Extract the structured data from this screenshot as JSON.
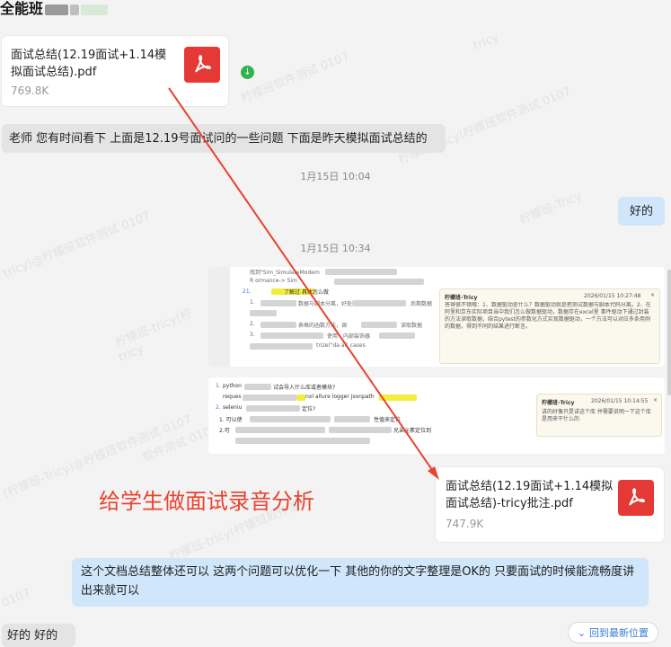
{
  "header": {
    "title": "全能班"
  },
  "messages": {
    "file1": {
      "name": "面试总结(12.19面试+1.14模拟面试总结).pdf",
      "size": "769.8K"
    },
    "msg1": "老师 您有时间看下 上面是12.19号面试问的一些问题 下面是昨天模拟面试总结的",
    "time1": "1月15日 10:04",
    "reply1": "好的",
    "time2": "1月15日 10:34",
    "shot1": {
      "line1": "找到\"Sim_SimulateModem",
      "line2": "R                  ormance-> Sim",
      "item21": "21.",
      "item21_text": "了解过 具体怎么做",
      "sub1": "1.",
      "sub1_text": "数据与脚本分离，好处",
      "sub1_tail": "后期数据",
      "sub2": "2.",
      "sub2_text": "表格的函数方法，调",
      "sub2_tail": "读取数据",
      "sub3": "3.",
      "sub3_text": "使用",
      "sub3_tail": "内部装饰器",
      "code": "trize(\"da          all_cases",
      "comment": {
        "author": "柠檬班-Tricy",
        "date": "2026/01/15 10:27:48",
        "body": "答得很不错哦：1、数据驱动是什么？数据驱动就是把测试数据与脚本代码分离。2、在阿里和京东实际项目当中我们怎么做数据驱动，数据存在excel里 事件驱动下通过封装的方法读取数据，结合pytest的参数化方式实现数据驱动，一个方法可以对应多条用例的数据，得到不同的结果进行断言。"
      }
    },
    "shot2": {
      "q1": "1.",
      "q1_text": "python",
      "q1_tail": "试会导入什么库或者模块?",
      "req": "reques",
      "libs": "nxl allure logger jsonpath",
      "q2": "2.",
      "q2_text": "seleniu",
      "q2_tail": "定位?",
      "a1": "1. 可以使",
      "a1_tail": "性值来定位",
      "a2": "2.可",
      "a2_tail": "兄弟元素定位到",
      "comment": {
        "author": "柠檬班-Tricy",
        "date": "2026/01/15 10:14:55",
        "body": "讲的好像只是讲这个库 并需要说明一下这个库是用来干什么的"
      }
    },
    "file2": {
      "name": "面试总结(12.19面试+1.14模拟面试总结)-tricy批注.pdf",
      "size": "747.9K"
    },
    "reply2": "这个文档总结整体还可以  这两个问题可以优化一下  其他的你的文字整理是OK的  只要面试的时候能流畅度讲出来就可以",
    "msg2": "好的 好的"
  },
  "annotation": "给学生做面试录音分析",
  "back_button": "回到最新位置",
  "watermarks": [
    "tricy",
    "柠檬班软件测试 0107",
    "柠檬班-tricy(柠檬班软件测试 0107",
    "tricy)@柠檬班软件测试 0107",
    "柠檬班-tricy(柠",
    "tricy",
    "软件测试 0107",
    "(柠檬班-Tricy)@柠檬班软件测试 0107",
    "柠檬班-tricy(柠檬班软件测试",
    "tricy",
    "柠檬班-Tricy",
    "0107"
  ],
  "colors": {
    "pdf": "#e53935",
    "outgoing": "#cfe6fb",
    "incoming": "#e4e4e4",
    "annotation": "#e8432f",
    "download": "#2fb24f"
  }
}
